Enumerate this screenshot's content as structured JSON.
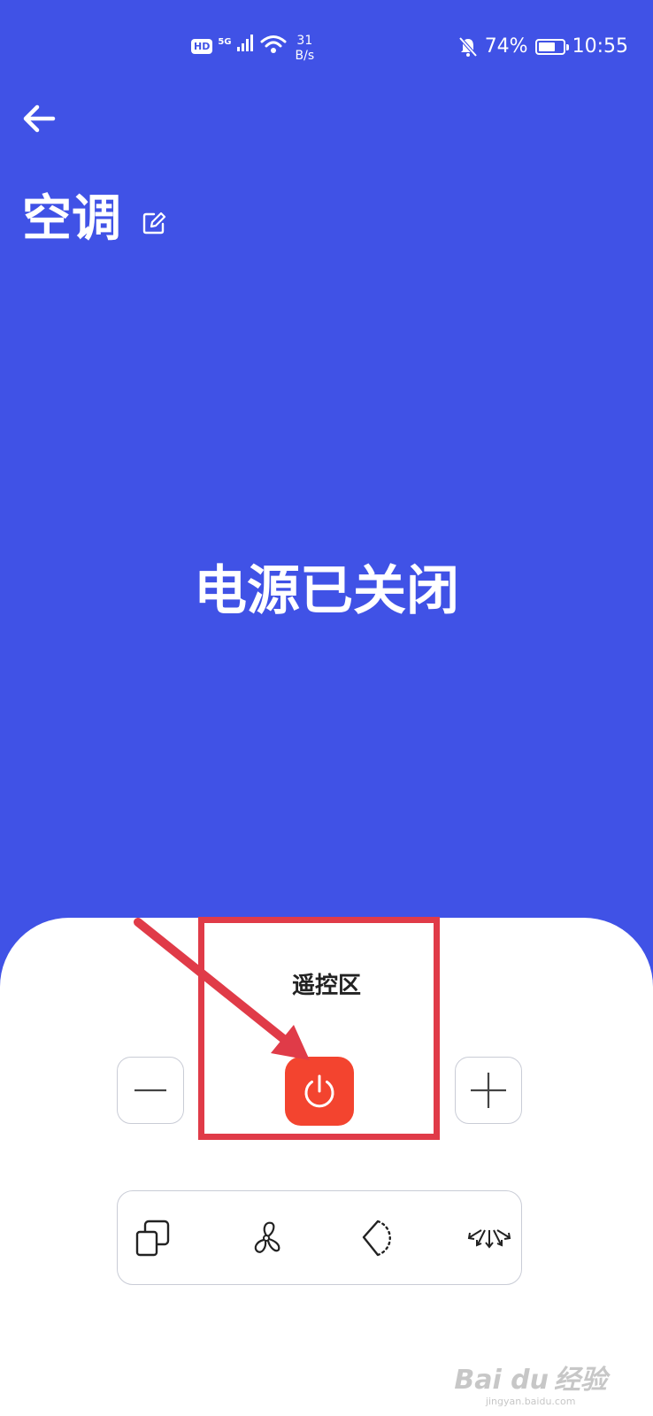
{
  "status_bar": {
    "hd": "HD",
    "signal_5g": "5G",
    "net_speed_value": "31",
    "net_speed_unit": "B/s",
    "battery_percent_text": "74%",
    "battery_level": 0.74,
    "time": "10:55"
  },
  "header": {
    "back_icon": "arrow-left-icon",
    "device_name": "空调",
    "edit_icon": "edit-icon"
  },
  "status_message": "电源已关闭",
  "remote": {
    "title": "遥控区",
    "minus_icon": "minus-icon",
    "power_icon": "power-icon",
    "plus_icon": "plus-icon",
    "power_color": "#f3442f",
    "modes": [
      {
        "icon": "mode-icon"
      },
      {
        "icon": "fan-icon"
      },
      {
        "icon": "swing-icon"
      },
      {
        "icon": "airflow-direction-icon"
      }
    ]
  },
  "annotation": {
    "color": "#e03b48"
  },
  "watermark": {
    "brand": "Bai du",
    "cn": "经验",
    "url": "jingyan.baidu.com"
  },
  "colors": {
    "background": "#4052e6",
    "panel": "#ffffff"
  }
}
